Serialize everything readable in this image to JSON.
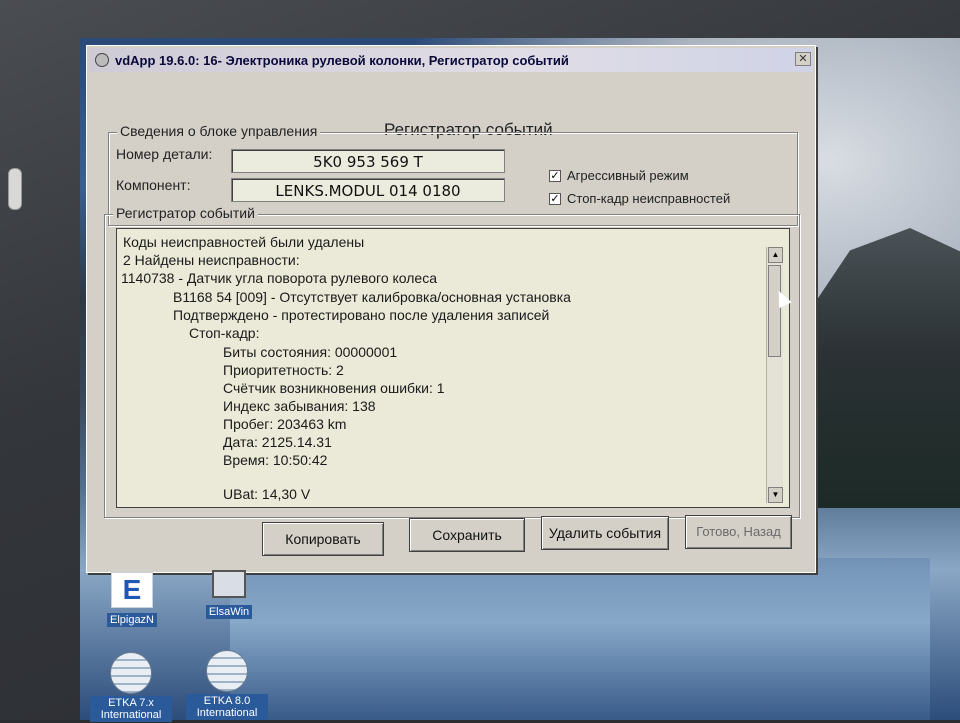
{
  "window": {
    "title": "vdApp 19.6.0: 16- Электроника рулевой колонки, Регистратор событий",
    "heading": "Регистратор событий",
    "close_glyph": "✕"
  },
  "controller_info": {
    "group_label": "Сведения о блоке управления",
    "part_number_label": "Номер детали:",
    "part_number": "5K0 953 569 T",
    "component_label": "Компонент:",
    "component": "LENKS.MODUL   014 0180",
    "aggressive_mode_label": "Агрессивный режим",
    "aggressive_mode_checked": true,
    "freeze_frame_label": "Стоп-кадр неисправностей",
    "freeze_frame_checked": true,
    "check_mark": "✓"
  },
  "event_log": {
    "group_label": "Регистратор событий",
    "lines": [
      "Коды неисправностей были удалены",
      "2 Найдены неисправности:",
      "1140738 - Датчик угла поворота рулевого колеса",
      "B1168 54 [009] - Отсутствует калибровка/основная установка",
      "Подтверждено - протестировано после удаления записей",
      "Стоп-кадр:",
      "Биты состояния: 00000001",
      "Приоритетность: 2",
      "Счётчик возникновения ошибки: 1",
      "Индекс забывания: 138",
      "Пробег: 203463 km",
      "Дата: 2125.14.31",
      "Время: 10:50:42",
      "",
      "UBat: 14,30 V"
    ],
    "scroll_up": "▲",
    "scroll_down": "▼"
  },
  "buttons": {
    "copy": "Копировать",
    "save": "Сохранить",
    "delete_events": "Удалить события",
    "done_back": "Готово, Назад"
  },
  "desktop_icons": [
    {
      "label": "ElpigazN",
      "glyph": "E"
    },
    {
      "label": "ElsaWin"
    },
    {
      "label": "ETKA 7.x International"
    },
    {
      "label": "ETKA 8.0 International"
    }
  ]
}
